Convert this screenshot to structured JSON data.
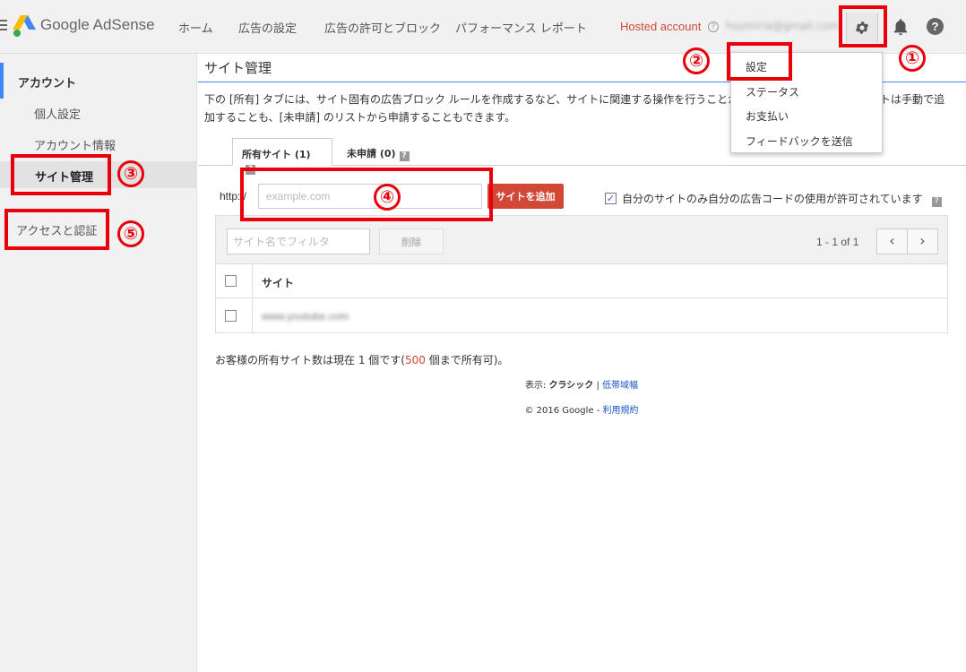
{
  "header": {
    "logo_text": "Google AdSense",
    "nav": [
      "ホーム",
      "広告の設定",
      "広告の許可とブロック",
      "パフォーマンス レポート"
    ],
    "hosted_account": "Hosted account",
    "help_mark": "?",
    "email": "hozmiria@gmail.com",
    "help_icon_text": "?"
  },
  "dropdown": {
    "items": [
      "設定",
      "ステータス",
      "お支払い",
      "フィードバックを送信"
    ]
  },
  "sidebar": {
    "section": "アカウント",
    "items": [
      "個人設定",
      "アカウント情報",
      "サイト管理",
      "アクセスと認証"
    ]
  },
  "main": {
    "title": "サイト管理",
    "description": "下の [所有] タブには、サイト固有の広告ブロック ルールを作成するなど、サイトに関連する操作を行うことがで",
    "description_tail": "イトは手動で追",
    "description_line2": "加することも、[未申請] のリストから申請することもできます。",
    "tabs": [
      {
        "label": "所有サイト (1)",
        "help": "?"
      },
      {
        "label": "未申請 (0)",
        "help": "?"
      }
    ],
    "http_label": "http://",
    "site_input_placeholder": "example.com",
    "add_button": "サイトを追加",
    "own_code_check": "✓",
    "own_code_label": "自分のサイトのみ自分の広告コードの使用が許可されています",
    "own_code_help": "?",
    "filter_placeholder": "サイト名でフィルタ",
    "delete_button": "削除",
    "pager": "1 - 1 of 1",
    "pager_prev": "‹",
    "pager_next": "›",
    "column_site": "サイト",
    "rows": [
      {
        "site": "www.youtube.com"
      }
    ],
    "count_prefix": "お客様の所有サイト数は現在 ",
    "count_num": "1",
    "count_mid": " 個です(",
    "count_max": "500",
    "count_suffix": " 個まで所有可)。"
  },
  "footer": {
    "view_label": "表示: ",
    "view_classic": "クラシック",
    "sep": " | ",
    "view_low": "低帯域幅",
    "copyright": "© 2016 Google",
    "dash": " - ",
    "terms": "利用規約"
  },
  "annotations": {
    "numbers": [
      "①",
      "②",
      "③",
      "④",
      "⑤"
    ],
    "color": "#e8000b"
  },
  "colors": {
    "accent_blue": "#4285f4",
    "adsense_red": "#d14836",
    "link_blue": "#1a55c8"
  }
}
